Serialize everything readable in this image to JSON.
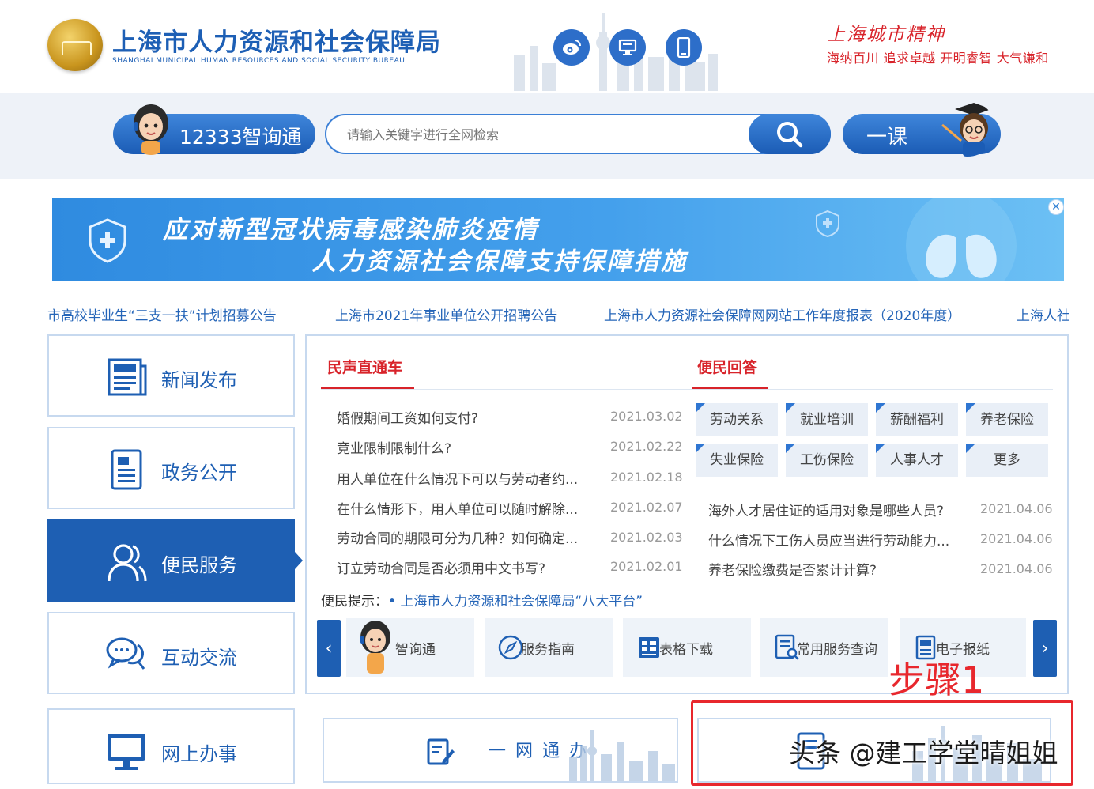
{
  "header": {
    "title": "上海市人力资源和社会保障局",
    "subtitle": "SHANGHAI MUNICIPAL HUMAN RESOURCES AND SOCIAL SECURITY BUREAU",
    "icons": [
      "weibo-icon",
      "desktop-icon",
      "mobile-icon"
    ],
    "spirit_title": "上海城市精神",
    "spirit_motto": "海纳百川  追求卓越  开明睿智  大气谦和"
  },
  "search": {
    "zxt_label": "12333智询通",
    "placeholder": "请输入关键字进行全网检索",
    "yike_label": "一课"
  },
  "banner": {
    "line1": "应对新型冠状病毒感染肺炎疫情",
    "line2": "人力资源社会保障支持保障措施",
    "close": "✕"
  },
  "ticker": [
    "市高校毕业生“三支一扶”计划招募公告",
    "上海市2021年事业单位公开招聘公告",
    "上海市人力资源社会保障网网站工作年度报表（2020年度）",
    "上海人社"
  ],
  "nav": [
    {
      "label": "新闻发布",
      "icon": "newspaper-icon"
    },
    {
      "label": "政务公开",
      "icon": "document-icon"
    },
    {
      "label": "便民服务",
      "icon": "users-icon",
      "active": true
    },
    {
      "label": "互动交流",
      "icon": "chat-bubbles-icon"
    },
    {
      "label": "网上办事",
      "icon": "monitor-icon"
    }
  ],
  "voice": {
    "title": "民声直通车",
    "items": [
      {
        "q": "婚假期间工资如何支付?",
        "date": "2021.03.02"
      },
      {
        "q": "竞业限制限制什么?",
        "date": "2021.02.22"
      },
      {
        "q": "用人单位在什么情况下可以与劳动者约...",
        "date": "2021.02.18"
      },
      {
        "q": "在什么情形下，用人单位可以随时解除...",
        "date": "2021.02.07"
      },
      {
        "q": "劳动合同的期限可分为几种？如何确定...",
        "date": "2021.02.03"
      },
      {
        "q": "订立劳动合同是否必须用中文书写?",
        "date": "2021.02.01"
      }
    ]
  },
  "answers": {
    "title": "便民回答",
    "categories": [
      "劳动关系",
      "就业培训",
      "薪酬福利",
      "养老保险",
      "失业保险",
      "工伤保险",
      "人事人才",
      "更多"
    ],
    "items": [
      {
        "q": "海外人才居住证的适用对象是哪些人员?",
        "date": "2021.04.06"
      },
      {
        "q": "什么情况下工伤人员应当进行劳动能力...",
        "date": "2021.04.06"
      },
      {
        "q": "养老保险缴费是否累计计算?",
        "date": "2021.04.06"
      }
    ]
  },
  "tips": {
    "label": "便民提示：",
    "link": "• 上海市人力资源和社会保障局“八大平台”"
  },
  "services": [
    {
      "label": "智询通",
      "icon": "assistant-avatar-icon"
    },
    {
      "label": "服务指南",
      "icon": "compass-icon"
    },
    {
      "label": "表格下载",
      "icon": "table-download-icon"
    },
    {
      "label": "常用服务查询",
      "icon": "search-document-icon"
    },
    {
      "label": "电子报纸",
      "icon": "e-newspaper-icon"
    }
  ],
  "carousel": {
    "prev": "‹",
    "next": "›"
  },
  "bottom": {
    "yiwang_label": "一网通办",
    "step_label": "步骤1",
    "watermark": "头条 @建工学堂晴姐姐"
  },
  "colors": {
    "brand_blue": "#1e5fb3",
    "accent_red": "#d8232a",
    "annotation_red": "#e8272d"
  }
}
